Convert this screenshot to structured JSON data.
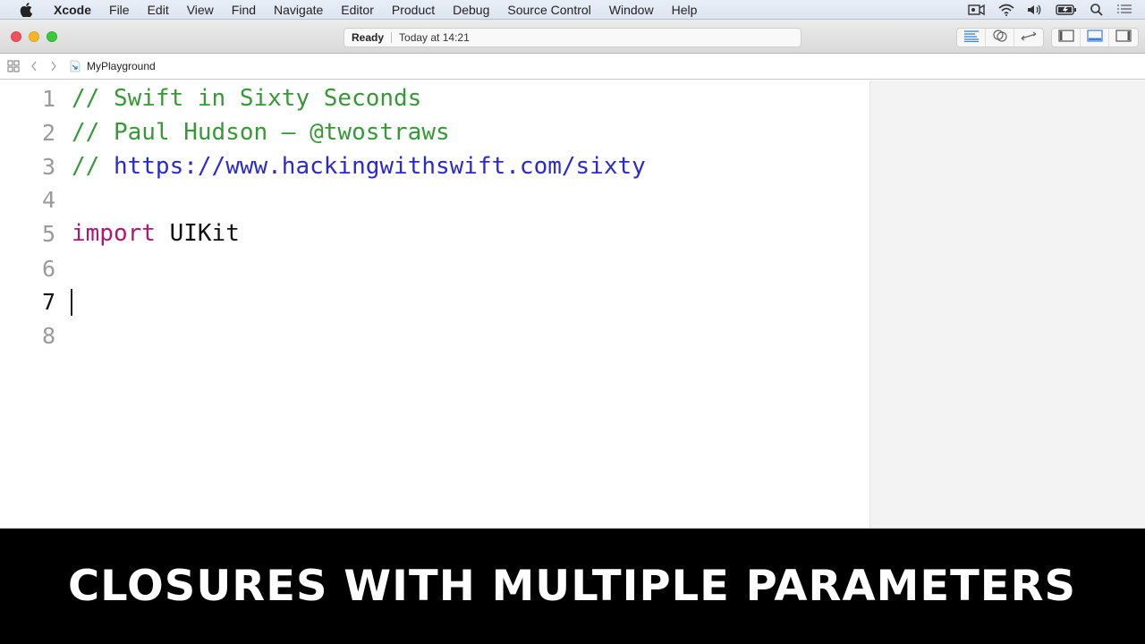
{
  "menubar": {
    "app_name": "Xcode",
    "items": [
      "File",
      "Edit",
      "View",
      "Find",
      "Navigate",
      "Editor",
      "Product",
      "Debug",
      "Source Control",
      "Window",
      "Help"
    ],
    "status_icons": [
      "screen-record-icon",
      "wifi-icon",
      "volume-icon",
      "battery-charging-icon",
      "spotlight-search-icon",
      "notification-center-icon"
    ]
  },
  "toolbar": {
    "activity_status": "Ready",
    "activity_time": "Today at 14:21",
    "editor_modes": [
      "standard-editor-icon",
      "assistant-editor-icon",
      "version-editor-icon"
    ],
    "panel_toggles": [
      "navigator-toggle-icon",
      "debug-area-toggle-icon",
      "utilities-toggle-icon"
    ],
    "accent_color": "#3b82d9"
  },
  "jumpbar": {
    "file_name": "MyPlayground"
  },
  "editor": {
    "current_line": 7,
    "lines": [
      {
        "number": "1",
        "tokens": [
          {
            "type": "comment",
            "text": "// Swift in Sixty Seconds"
          }
        ]
      },
      {
        "number": "2",
        "tokens": [
          {
            "type": "comment",
            "text": "// Paul Hudson — @twostraws"
          }
        ]
      },
      {
        "number": "3",
        "tokens": [
          {
            "type": "comment",
            "text": "// "
          },
          {
            "type": "url",
            "text": "https://www.hackingwithswift.com/sixty"
          }
        ]
      },
      {
        "number": "4",
        "tokens": []
      },
      {
        "number": "5",
        "tokens": [
          {
            "type": "keyword",
            "text": "import"
          },
          {
            "type": "plain",
            "text": " UIKit"
          }
        ]
      },
      {
        "number": "6",
        "tokens": []
      },
      {
        "number": "7",
        "tokens": []
      },
      {
        "number": "8",
        "tokens": []
      }
    ],
    "colors": {
      "comment": "#359a35",
      "url": "#2a2ad0",
      "keyword": "#b0176d",
      "plain": "#111111"
    }
  },
  "banner": {
    "title": "CLOSURES WITH MULTIPLE PARAMETERS"
  }
}
